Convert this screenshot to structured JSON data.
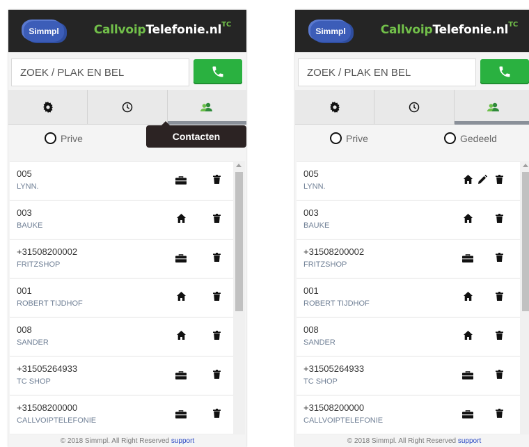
{
  "brand": {
    "logo": "Simmpl",
    "name_green": "Callvoip",
    "name_white": "Telefonie.nl",
    "superscript": "TC"
  },
  "search": {
    "placeholder": "ZOEK / PLAK EN BEL"
  },
  "tabs": [
    {
      "icon": "gear-icon"
    },
    {
      "icon": "clock-icon"
    },
    {
      "icon": "contacts-icon"
    }
  ],
  "radio": {
    "private": "Prive",
    "shared": "Gedeeld"
  },
  "tooltip": "Contacten",
  "contacts": [
    {
      "number": "005",
      "name": "LYNN."
    },
    {
      "number": "003",
      "name": "BAUKE"
    },
    {
      "number": "+31508200002",
      "name": "FRITZSHOP"
    },
    {
      "number": "001",
      "name": "ROBERT TIJDHOF"
    },
    {
      "number": "008",
      "name": "SANDER"
    },
    {
      "number": "+31505264933",
      "name": "TC SHOP"
    },
    {
      "number": "+31508200000",
      "name": "CALLVOIPTELEFONIE"
    }
  ],
  "left_panel_icons": [
    "briefcase-icon",
    "home-icon",
    "briefcase-icon",
    "home-icon",
    "home-icon",
    "briefcase-icon",
    "briefcase-icon"
  ],
  "right_panel_icons": [
    "home-icon",
    "home-icon",
    "briefcase-icon",
    "home-icon",
    "home-icon",
    "briefcase-icon",
    "briefcase-icon"
  ],
  "footer": {
    "text": "© 2018 Simmpl. All Right Reserved",
    "link": "support"
  },
  "colors": {
    "header": "#252525",
    "accent_green": "#72c04a",
    "call_button": "#2ab140",
    "tooltip": "#2c2323"
  }
}
